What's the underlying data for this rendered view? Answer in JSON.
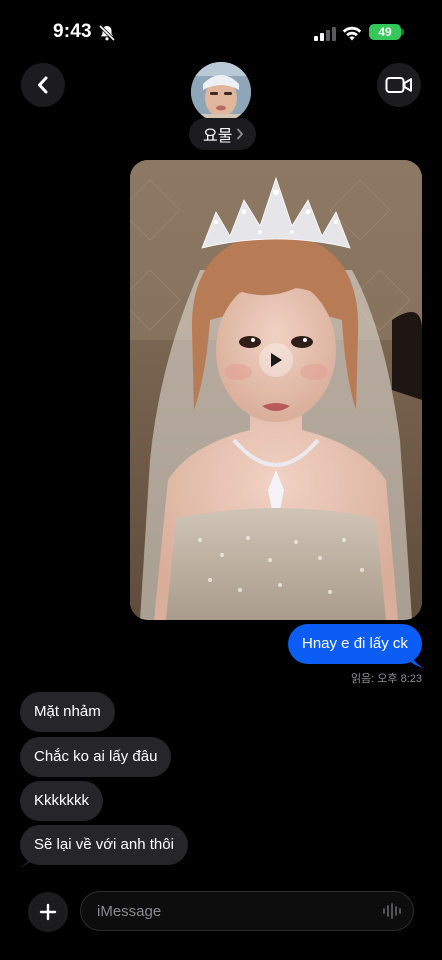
{
  "status_bar": {
    "time": "9:43",
    "battery_level": "49"
  },
  "header": {
    "contact_name": "요물",
    "icons": [
      "back-chevron-icon",
      "video-camera-icon",
      "bell-slash-icon",
      "cellular-icon",
      "wifi-icon"
    ]
  },
  "messages": {
    "outgoing": [
      {
        "text": "Hnay e đi lấy ck"
      }
    ],
    "read_receipt": "읽음: 오후 8:23",
    "incoming": [
      {
        "text": "Mặt nhảm"
      },
      {
        "text": "Chắc ko ai lấy đâu"
      },
      {
        "text": "Kkkkkkk"
      },
      {
        "text": "Sẽ lại về với anh thôi"
      }
    ]
  },
  "composer": {
    "placeholder": "iMessage"
  },
  "colors": {
    "outgoing_bubble": "#0b5df5",
    "incoming_bubble": "#262629",
    "battery": "#34c759",
    "background": "#000000"
  }
}
